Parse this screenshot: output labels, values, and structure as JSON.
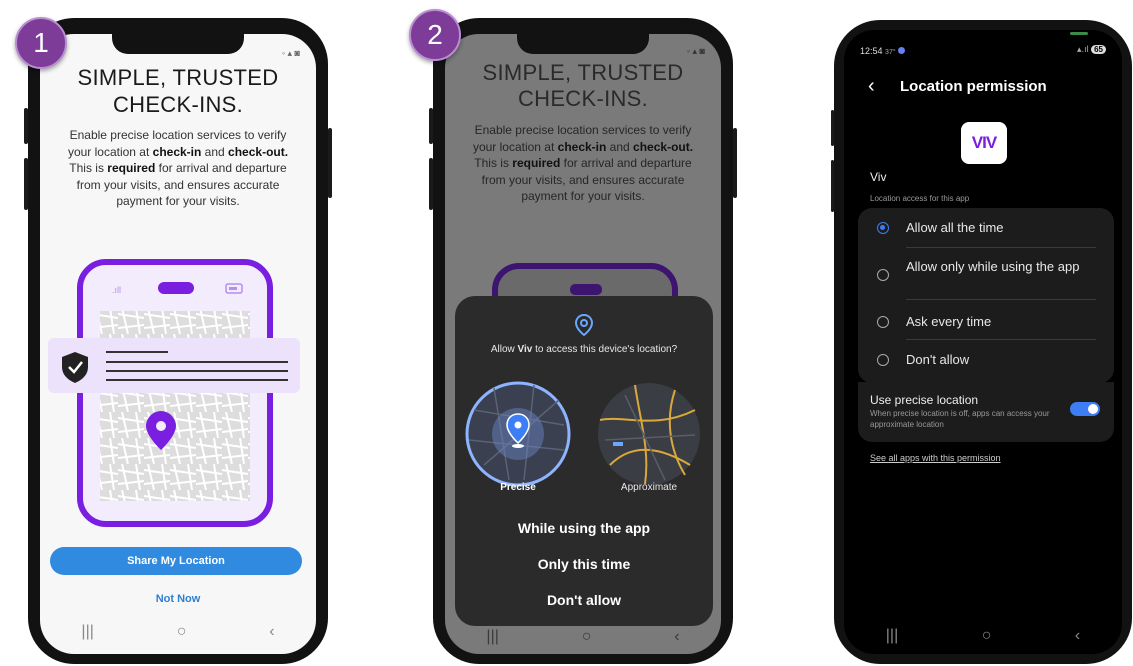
{
  "steps": [
    "1",
    "2"
  ],
  "screen1": {
    "headline_line1": "SIMPLE, TRUSTED",
    "headline_line2": "CHECK-INS.",
    "para_1": "Enable precise location services to verify your location at ",
    "para_b1": "check-in",
    "para_2": " and ",
    "para_b2": "check-out.",
    "para_3": " This is ",
    "para_b3": "required",
    "para_4": " for arrival and departure from your visits, and ensures accurate payment for your visits.",
    "share_button": "Share My Location",
    "not_now": "Not Now"
  },
  "screen2": {
    "dialog_prefix": "Allow ",
    "dialog_app": "Viv",
    "dialog_suffix": " to access this device's location?",
    "precise_label": "Precise",
    "approximate_label": "Approximate",
    "option_while_using": "While using the app",
    "option_only_this_time": "Only this time",
    "option_dont_allow": "Don't allow"
  },
  "screen3": {
    "time": "12:54",
    "temp": "37°",
    "battery": "65",
    "title": "Location permission",
    "app_logo_text": "VIV",
    "app_name": "Viv",
    "section_label": "Location access for this app",
    "options": [
      {
        "label": "Allow all the time",
        "selected": true
      },
      {
        "label": "Allow only while using the app",
        "selected": false
      },
      {
        "label": "Ask every time",
        "selected": false
      },
      {
        "label": "Don't allow",
        "selected": false
      }
    ],
    "precise_title": "Use precise location",
    "precise_desc": "When precise location is off, apps can access your approximate location",
    "precise_on": true,
    "see_all_link": "See all apps with this permission"
  },
  "nav_icons": [
    "recents-icon",
    "home-icon",
    "back-icon"
  ],
  "colors": {
    "accent_purple": "#7a1fe0",
    "button_blue": "#2f8ae0",
    "toggle_blue": "#3d7ef5",
    "step_badge": "#7d3c98"
  }
}
